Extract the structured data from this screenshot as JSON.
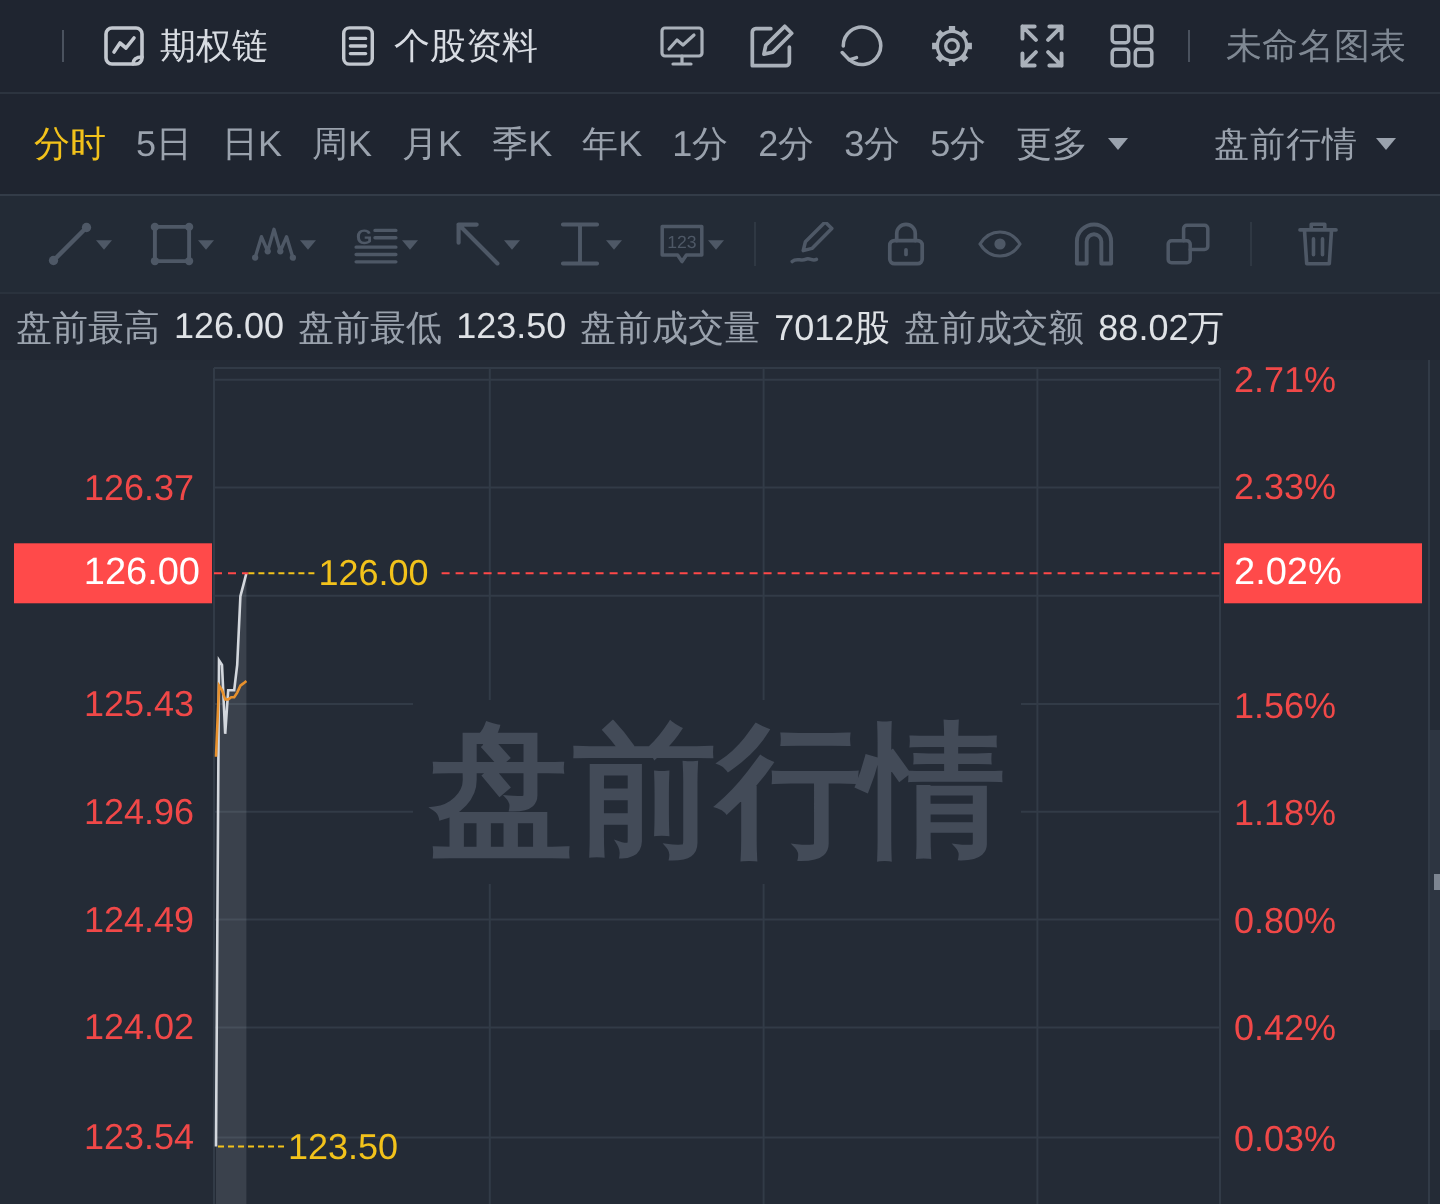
{
  "topbar": {
    "option_chain": "期权链",
    "stock_profile": "个股资料",
    "layout_name": "未命名图表"
  },
  "periods": [
    {
      "label": "分时",
      "kind": "tab",
      "selected": true
    },
    {
      "label": "5日",
      "kind": "tab",
      "selected": false
    },
    {
      "label": "日K",
      "kind": "tab",
      "selected": false
    },
    {
      "label": "周K",
      "kind": "tab",
      "selected": false
    },
    {
      "label": "月K",
      "kind": "tab",
      "selected": false
    },
    {
      "label": "季K",
      "kind": "tab",
      "selected": false
    },
    {
      "label": "年K",
      "kind": "tab",
      "selected": false
    },
    {
      "label": "1分",
      "kind": "tab",
      "selected": false
    },
    {
      "label": "2分",
      "kind": "tab",
      "selected": false
    },
    {
      "label": "3分",
      "kind": "tab",
      "selected": false
    },
    {
      "label": "5分",
      "kind": "tab",
      "selected": false
    },
    {
      "label": "更多",
      "kind": "dropdown",
      "selected": false
    }
  ],
  "session_selector": {
    "label": "盘前行情"
  },
  "drawing_tools": {
    "text_tool_letter": "G",
    "note_tool_label": "123"
  },
  "stats": [
    {
      "label": "盘前最高",
      "value": "126.00"
    },
    {
      "label": "盘前最低",
      "value": "123.50"
    },
    {
      "label": "盘前成交量",
      "value": "7012股"
    },
    {
      "label": "盘前成交额",
      "value": "88.02万"
    }
  ],
  "chart": {
    "session_watermark": "盘前行情",
    "price_tag": "126.00",
    "change_tag": "2.02%",
    "high_label": "126.00",
    "low_label": "123.50",
    "chart_data": {
      "type": "line",
      "grid": true,
      "categories": [
        null,
        null,
        null,
        null,
        null,
        null,
        null,
        null,
        null,
        null,
        null,
        null,
        null,
        null,
        null,
        null,
        null,
        null,
        null,
        null,
        null,
        null,
        null,
        null,
        null,
        null,
        null,
        null,
        null,
        null,
        null,
        null,
        null,
        null,
        null,
        null,
        null,
        null,
        null,
        null,
        null,
        null,
        null,
        null,
        null,
        null,
        null,
        null,
        null,
        null,
        null,
        null,
        null,
        null,
        null,
        null,
        null,
        null,
        null,
        null,
        null,
        null,
        null,
        null,
        null,
        null,
        null,
        null,
        null,
        null,
        null,
        null,
        null,
        null,
        null,
        null,
        null,
        null,
        null,
        null,
        null,
        null,
        null,
        null,
        null,
        null,
        null,
        null,
        null,
        null,
        null,
        null,
        null,
        null,
        null,
        null,
        null,
        null,
        null,
        null,
        null,
        null,
        null,
        null,
        null,
        null,
        null,
        null,
        null,
        null,
        null,
        null,
        null,
        null,
        null,
        null,
        null,
        null,
        null,
        null,
        null,
        null,
        null,
        null,
        null,
        null,
        null,
        null,
        null,
        null,
        null,
        null,
        null,
        null,
        null,
        null,
        null,
        null,
        null,
        null,
        null,
        null,
        null,
        null,
        null,
        null,
        null,
        null,
        null,
        null,
        null,
        null,
        null,
        null,
        null,
        null,
        null,
        null,
        null,
        null,
        null,
        null,
        null,
        null,
        null,
        null,
        null,
        null,
        null,
        null,
        null,
        null,
        null,
        null,
        null,
        null,
        null,
        null,
        null,
        null,
        null,
        null,
        null,
        null,
        null,
        null,
        null,
        null,
        null,
        null,
        null,
        null,
        null,
        null,
        null,
        null,
        null,
        null,
        null,
        null,
        null,
        null,
        null,
        null,
        null,
        null,
        null,
        null,
        null,
        null,
        null,
        null,
        null,
        null,
        null,
        null,
        null,
        null,
        null,
        null,
        null,
        null,
        null,
        null,
        null,
        null,
        null,
        null,
        null,
        null,
        null,
        null,
        null,
        null,
        null,
        null,
        null,
        null,
        null,
        null,
        null,
        null,
        null,
        null,
        null,
        null,
        null,
        null,
        null,
        null,
        null,
        null,
        null,
        null,
        null,
        null,
        null,
        null,
        null,
        null,
        null,
        null,
        null,
        null,
        null,
        null,
        null,
        null,
        null,
        null,
        null,
        null,
        null,
        null,
        null,
        null,
        null,
        null,
        null,
        null,
        null,
        null,
        null,
        null,
        null,
        null,
        null,
        null,
        null,
        null,
        null,
        null,
        null,
        null,
        null,
        null,
        null,
        null,
        null,
        null,
        null,
        null,
        null,
        null,
        null,
        null,
        null,
        null,
        null,
        null,
        null,
        null,
        null,
        null,
        null,
        null,
        null,
        null,
        null,
        null,
        null,
        null,
        null,
        null,
        null,
        null,
        null,
        null,
        null,
        null,
        null
      ],
      "ylim": [
        123.25,
        126.93
      ],
      "y2lim": [
        -0.2,
        2.78
      ],
      "yticks": [
        {
          "value": 126.37,
          "label": "126.37"
        },
        {
          "value": 125.43,
          "label": "125.43"
        },
        {
          "value": 124.96,
          "label": "124.96"
        },
        {
          "value": 124.49,
          "label": "124.49"
        },
        {
          "value": 124.02,
          "label": "124.02"
        },
        {
          "value": 123.54,
          "label": "123.54"
        }
      ],
      "y2ticks": [
        {
          "value": 2.71,
          "label": "2.71%"
        },
        {
          "value": 2.33,
          "label": "2.33%"
        },
        {
          "value": 1.56,
          "label": "1.56%"
        },
        {
          "value": 1.18,
          "label": "1.18%"
        },
        {
          "value": 0.8,
          "label": "0.80%"
        },
        {
          "value": 0.42,
          "label": "0.42%"
        },
        {
          "value": 0.03,
          "label": "0.03%"
        }
      ],
      "series": [
        {
          "color": "#d3d7dd",
          "values": [
            123.5,
            125.62,
            125.6,
            125.3,
            125.49,
            125.49,
            125.49,
            125.6,
            125.9,
            125.95,
            126.0,
            null,
            null,
            null,
            null,
            null,
            null,
            null,
            null,
            null,
            null,
            null,
            null,
            null,
            null,
            null,
            null,
            null,
            null,
            null,
            null,
            null,
            null,
            null,
            null,
            null,
            null,
            null,
            null,
            null,
            null,
            null,
            null,
            null,
            null,
            null,
            null,
            null,
            null,
            null,
            null,
            null,
            null,
            null,
            null,
            null,
            null,
            null,
            null,
            null,
            null,
            null,
            null,
            null,
            null,
            null,
            null,
            null,
            null,
            null,
            null,
            null,
            null,
            null,
            null,
            null,
            null,
            null,
            null,
            null,
            null,
            null,
            null,
            null,
            null,
            null,
            null,
            null,
            null,
            null,
            null,
            null,
            null,
            null,
            null,
            null,
            null,
            null,
            null,
            null,
            null,
            null,
            null,
            null,
            null,
            null,
            null,
            null,
            null,
            null,
            null,
            null,
            null,
            null,
            null,
            null,
            null,
            null,
            null,
            null,
            null,
            null,
            null,
            null,
            null,
            null,
            null,
            null,
            null,
            null,
            null,
            null,
            null,
            null,
            null,
            null,
            null,
            null,
            null,
            null,
            null,
            null,
            null,
            null,
            null,
            null,
            null,
            null,
            null,
            null,
            null,
            null,
            null,
            null,
            null,
            null,
            null,
            null,
            null,
            null,
            null,
            null,
            null,
            null,
            null,
            null,
            null,
            null,
            null,
            null,
            null,
            null,
            null,
            null,
            null,
            null,
            null,
            null,
            null,
            null,
            null,
            null,
            null,
            null,
            null,
            null,
            null,
            null,
            null,
            null,
            null,
            null,
            null,
            null,
            null,
            null,
            null,
            null,
            null,
            null,
            null,
            null,
            null,
            null,
            null,
            null,
            null,
            null,
            null,
            null,
            null,
            null,
            null,
            null,
            null,
            null,
            null,
            null,
            null,
            null,
            null,
            null,
            null,
            null,
            null,
            null,
            null,
            null,
            null,
            null,
            null,
            null,
            null,
            null,
            null,
            null,
            null,
            null,
            null,
            null,
            null,
            null,
            null,
            null,
            null,
            null,
            null,
            null,
            null,
            null,
            null,
            null,
            null,
            null,
            null,
            null,
            null,
            null,
            null,
            null,
            null,
            null,
            null,
            null,
            null,
            null,
            null,
            null,
            null,
            null,
            null,
            null,
            null,
            null,
            null,
            null,
            null,
            null,
            null,
            null,
            null,
            null,
            null,
            null,
            null,
            null,
            null,
            null,
            null,
            null,
            null,
            null,
            null,
            null,
            null,
            null,
            null,
            null,
            null,
            null,
            null,
            null,
            null,
            null,
            null,
            null,
            null,
            null,
            null,
            null,
            null,
            null,
            null,
            null,
            null,
            null,
            null,
            null,
            null,
            null,
            null,
            null,
            null,
            null,
            null,
            null,
            null,
            null,
            null,
            null,
            null
          ]
        },
        {
          "color": "#e8912d",
          "values": [
            125.2,
            125.51,
            125.49,
            125.45,
            125.45,
            125.46,
            125.46,
            125.48,
            125.51,
            125.52,
            125.53,
            null,
            null,
            null,
            null,
            null,
            null,
            null,
            null,
            null,
            null,
            null,
            null,
            null,
            null,
            null,
            null,
            null,
            null,
            null,
            null,
            null,
            null,
            null,
            null,
            null,
            null,
            null,
            null,
            null,
            null,
            null,
            null,
            null,
            null,
            null,
            null,
            null,
            null,
            null,
            null,
            null,
            null,
            null,
            null,
            null,
            null,
            null,
            null,
            null,
            null,
            null,
            null,
            null,
            null,
            null,
            null,
            null,
            null,
            null,
            null,
            null,
            null,
            null,
            null,
            null,
            null,
            null,
            null,
            null,
            null,
            null,
            null,
            null,
            null,
            null,
            null,
            null,
            null,
            null,
            null,
            null,
            null,
            null,
            null,
            null,
            null,
            null,
            null,
            null,
            null,
            null,
            null,
            null,
            null,
            null,
            null,
            null,
            null,
            null,
            null,
            null,
            null,
            null,
            null,
            null,
            null,
            null,
            null,
            null,
            null,
            null,
            null,
            null,
            null,
            null,
            null,
            null,
            null,
            null,
            null,
            null,
            null,
            null,
            null,
            null,
            null,
            null,
            null,
            null,
            null,
            null,
            null,
            null,
            null,
            null,
            null,
            null,
            null,
            null,
            null,
            null,
            null,
            null,
            null,
            null,
            null,
            null,
            null,
            null,
            null,
            null,
            null,
            null,
            null,
            null,
            null,
            null,
            null,
            null,
            null,
            null,
            null,
            null,
            null,
            null,
            null,
            null,
            null,
            null,
            null,
            null,
            null,
            null,
            null,
            null,
            null,
            null,
            null,
            null,
            null,
            null,
            null,
            null,
            null,
            null,
            null,
            null,
            null,
            null,
            null,
            null,
            null,
            null,
            null,
            null,
            null,
            null,
            null,
            null,
            null,
            null,
            null,
            null,
            null,
            null,
            null,
            null,
            null,
            null,
            null,
            null,
            null,
            null,
            null,
            null,
            null,
            null,
            null,
            null,
            null,
            null,
            null,
            null,
            null,
            null,
            null,
            null,
            null,
            null,
            null,
            null,
            null,
            null,
            null,
            null,
            null,
            null,
            null,
            null,
            null,
            null,
            null,
            null,
            null,
            null,
            null,
            null,
            null,
            null,
            null,
            null,
            null,
            null,
            null,
            null,
            null,
            null,
            null,
            null,
            null,
            null,
            null,
            null,
            null,
            null,
            null,
            null,
            null,
            null,
            null,
            null,
            null,
            null,
            null,
            null,
            null,
            null,
            null,
            null,
            null,
            null,
            null,
            null,
            null,
            null,
            null,
            null,
            null,
            null,
            null,
            null,
            null,
            null,
            null,
            null,
            null,
            null,
            null,
            null,
            null,
            null,
            null,
            null,
            null,
            null,
            null,
            null,
            null,
            null,
            null,
            null,
            null,
            null,
            null,
            null,
            null,
            null,
            null,
            null,
            null
          ]
        }
      ]
    }
  }
}
